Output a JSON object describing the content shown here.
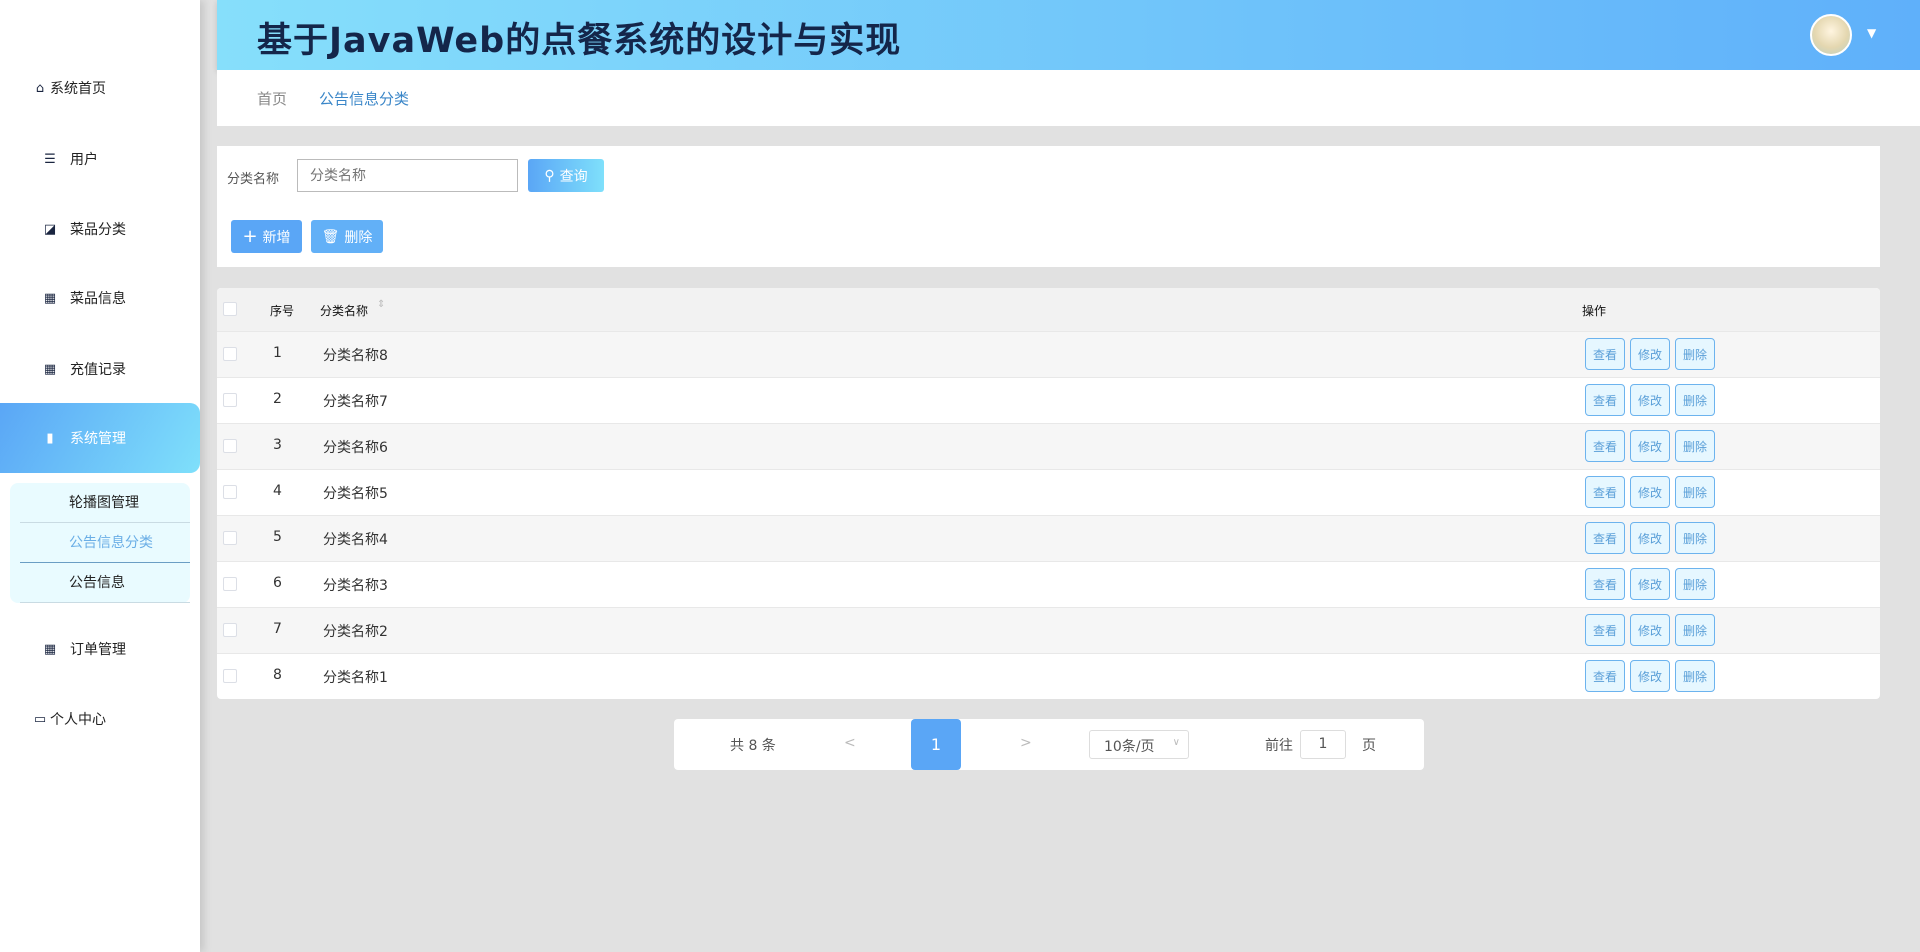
{
  "header": {
    "title": "基于JavaWeb的点餐系统的设计与实现"
  },
  "breadcrumb": [
    "首页",
    "公告信息分类"
  ],
  "sidebar": {
    "items": [
      {
        "label": "系统首页",
        "icon": "home-icon"
      },
      {
        "label": "用户",
        "icon": "sliders-icon"
      },
      {
        "label": "菜品分类",
        "icon": "chart-icon"
      },
      {
        "label": "菜品信息",
        "icon": "grid-icon"
      },
      {
        "label": "充值记录",
        "icon": "grid-icon"
      },
      {
        "label": "系统管理",
        "icon": "bar-chart-icon"
      },
      {
        "label": "订单管理",
        "icon": "grid-icon"
      },
      {
        "label": "个人中心",
        "icon": "card-icon"
      }
    ],
    "submenu": [
      "轮播图管理",
      "公告信息分类",
      "公告信息"
    ]
  },
  "search": {
    "label": "分类名称",
    "placeholder": "分类名称",
    "query_label": "查询",
    "add_label": "新增",
    "delete_label": "删除"
  },
  "table": {
    "headers": {
      "index": "序号",
      "name": "分类名称",
      "ops": "操作"
    },
    "rows": [
      {
        "index": "1",
        "name": "分类名称8"
      },
      {
        "index": "2",
        "name": "分类名称7"
      },
      {
        "index": "3",
        "name": "分类名称6"
      },
      {
        "index": "4",
        "name": "分类名称5"
      },
      {
        "index": "5",
        "name": "分类名称4"
      },
      {
        "index": "6",
        "name": "分类名称3"
      },
      {
        "index": "7",
        "name": "分类名称2"
      },
      {
        "index": "8",
        "name": "分类名称1"
      }
    ],
    "ops": {
      "view": "查看",
      "edit": "修改",
      "delete": "删除"
    }
  },
  "pagination": {
    "total": "共 8 条",
    "prev": "<",
    "page": "1",
    "next": ">",
    "page_size": "10条/页",
    "goto_label": "前往",
    "goto_value": "1",
    "page_suffix": "页"
  },
  "colors": {
    "accent": "#5aa6f6",
    "header_from": "#86dffb",
    "header_to": "#5fb0fa"
  }
}
